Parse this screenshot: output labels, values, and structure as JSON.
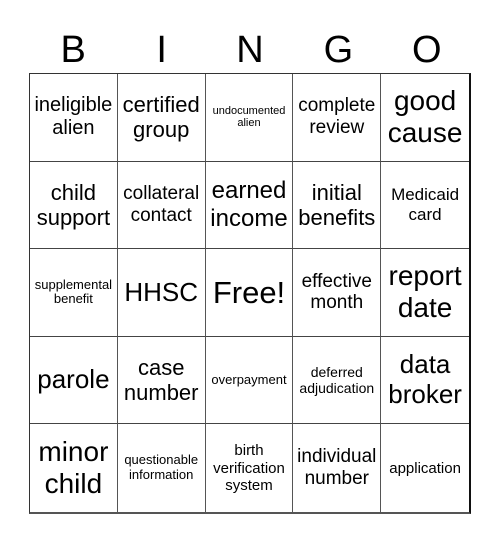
{
  "header": {
    "letters": [
      "B",
      "I",
      "N",
      "G",
      "O"
    ]
  },
  "cells": [
    "ineligible alien",
    "certified group",
    "undocumented alien",
    "complete review",
    "good cause",
    "child support",
    "collateral contact",
    "earned income",
    "initial benefits",
    "Medicaid card",
    "supplemental benefit",
    "HHSC",
    "Free!",
    "effective month",
    "report date",
    "parole",
    "case number",
    "overpayment",
    "deferred adjudication",
    "data broker",
    "minor child",
    "questionable information",
    "birth verification system",
    "individual number",
    "application"
  ]
}
